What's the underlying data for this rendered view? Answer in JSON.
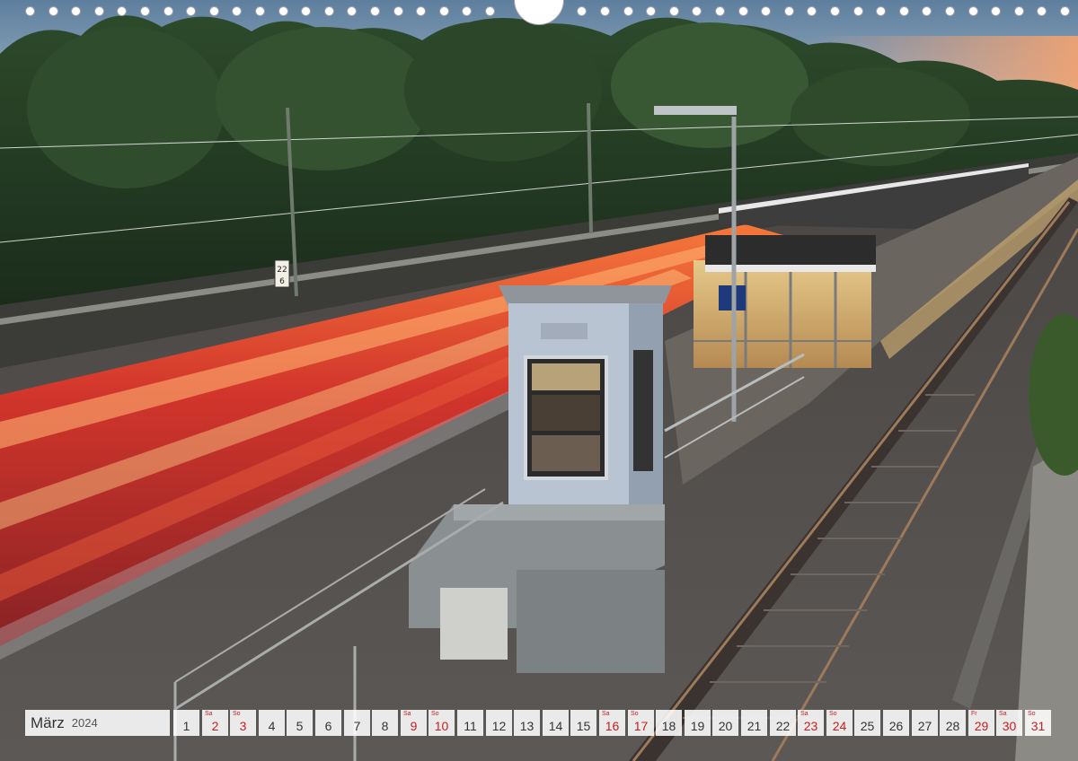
{
  "calendar": {
    "month": "März",
    "year": "2024",
    "days": [
      {
        "num": "1",
        "wd": "",
        "red": false
      },
      {
        "num": "2",
        "wd": "Sa",
        "red": true
      },
      {
        "num": "3",
        "wd": "So",
        "red": true
      },
      {
        "num": "4",
        "wd": "",
        "red": false
      },
      {
        "num": "5",
        "wd": "",
        "red": false
      },
      {
        "num": "6",
        "wd": "",
        "red": false
      },
      {
        "num": "7",
        "wd": "",
        "red": false
      },
      {
        "num": "8",
        "wd": "",
        "red": false
      },
      {
        "num": "9",
        "wd": "Sa",
        "red": true
      },
      {
        "num": "10",
        "wd": "So",
        "red": true
      },
      {
        "num": "11",
        "wd": "",
        "red": false
      },
      {
        "num": "12",
        "wd": "",
        "red": false
      },
      {
        "num": "13",
        "wd": "",
        "red": false
      },
      {
        "num": "14",
        "wd": "",
        "red": false
      },
      {
        "num": "15",
        "wd": "",
        "red": false
      },
      {
        "num": "16",
        "wd": "Sa",
        "red": true
      },
      {
        "num": "17",
        "wd": "So",
        "red": true
      },
      {
        "num": "18",
        "wd": "",
        "red": false
      },
      {
        "num": "19",
        "wd": "",
        "red": false
      },
      {
        "num": "20",
        "wd": "",
        "red": false
      },
      {
        "num": "21",
        "wd": "",
        "red": false
      },
      {
        "num": "22",
        "wd": "",
        "red": false
      },
      {
        "num": "23",
        "wd": "Sa",
        "red": true
      },
      {
        "num": "24",
        "wd": "So",
        "red": true
      },
      {
        "num": "25",
        "wd": "",
        "red": false
      },
      {
        "num": "26",
        "wd": "",
        "red": false
      },
      {
        "num": "27",
        "wd": "",
        "red": false
      },
      {
        "num": "28",
        "wd": "",
        "red": false
      },
      {
        "num": "29",
        "wd": "Fr",
        "red": true
      },
      {
        "num": "30",
        "wd": "Sa",
        "red": true
      },
      {
        "num": "31",
        "wd": "So",
        "red": true
      }
    ]
  },
  "photo": {
    "subject": "train-station-long-exposure",
    "km_sign": [
      "22",
      "6"
    ]
  },
  "colors": {
    "holiday_red": "#c81e1e",
    "strip_bg": "#ffffff"
  }
}
